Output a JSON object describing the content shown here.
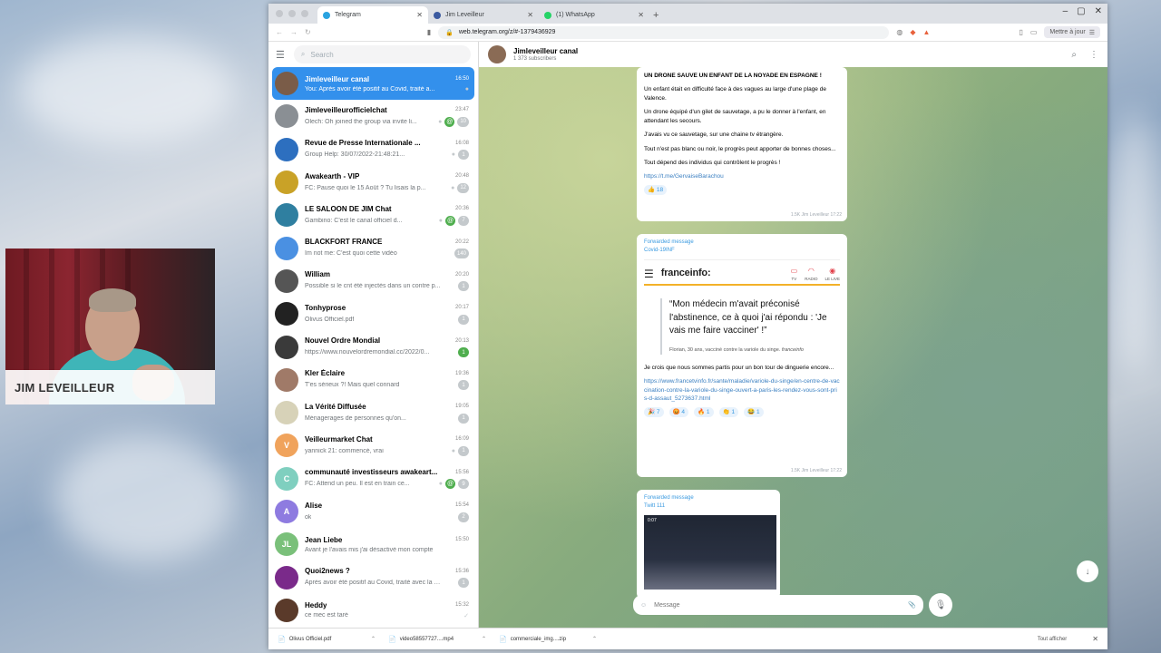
{
  "overlay": {
    "streamer_name": "JIM LEVEILLEUR"
  },
  "browser": {
    "tabs": [
      {
        "label": "Telegram",
        "color": "#2aa3e0",
        "active": true
      },
      {
        "label": "Jim Leveilleur",
        "color": "#3b5aa0",
        "active": false
      },
      {
        "label": "(1) WhatsApp",
        "color": "#25d366",
        "active": false
      }
    ],
    "url": "web.telegram.org/z/#-1379436929",
    "update_label": "Mettre à jour"
  },
  "sidebar": {
    "search_placeholder": "Search",
    "chats": [
      {
        "name": "Jimleveilleur canal",
        "time": "16:50",
        "msg": "You: Après avoir été positif au Covid, traité a...",
        "avatar_color": "#7a5c48",
        "initials": "",
        "active": true,
        "badges": [
          "pin"
        ]
      },
      {
        "name": "Jimleveilleurofficielchat",
        "time": "23:47",
        "msg": "Olech: Oh joined the group via invite li...",
        "avatar_color": "#8a8f94",
        "initials": "",
        "badges": [
          "pin",
          "mention",
          "count"
        ],
        "count": "10"
      },
      {
        "name": "Revue de Presse Internationale ...",
        "time": "16:08",
        "msg": "Group Help: 30/07/2022-21:48:21...",
        "avatar_color": "#2d6fbf",
        "initials": "",
        "badges": [
          "pin",
          "count"
        ],
        "count": "1"
      },
      {
        "name": "Awakearth - VIP",
        "time": "20:48",
        "msg": "FC: Pause quoi le 15 Août ? Tu lisais la p...",
        "avatar_color": "#c9a227",
        "initials": "",
        "badges": [
          "pin",
          "count"
        ],
        "count": "12"
      },
      {
        "name": "LE SALOON DE JIM Chat",
        "time": "20:36",
        "msg": "Gambino: C'est le canal officiel d...",
        "avatar_color": "#2f7fa0",
        "initials": "",
        "badges": [
          "pin",
          "mention",
          "count"
        ],
        "count": "7"
      },
      {
        "name": "BLACKFORT FRANCE",
        "time": "20:22",
        "msg": "Im not me: C'est quoi cette vidéo",
        "avatar_color": "#4a90e2",
        "initials": "",
        "badges": [
          "count"
        ],
        "count": "140"
      },
      {
        "name": "William",
        "time": "20:20",
        "msg": "Possible si le cnt été injectés dans un contre p...",
        "avatar_color": "#555555",
        "initials": "",
        "badges": [
          "count"
        ],
        "count": "1"
      },
      {
        "name": "Tonhyprose",
        "time": "20:17",
        "msg": "Olivus Officiel.pdf",
        "avatar_color": "#222222",
        "initials": "",
        "badges": [
          "count"
        ],
        "count": "1"
      },
      {
        "name": "Nouvel Ordre Mondial",
        "time": "20:13",
        "msg": "https://www.nouvelordremondial.cc/2022/0...",
        "avatar_color": "#3a3a3a",
        "initials": "",
        "badges": [
          "green-count"
        ],
        "count": "1"
      },
      {
        "name": "Kler Éclaire",
        "time": "19:36",
        "msg": "T'es sérieux ?! Mais quel connard",
        "avatar_color": "#a07a68",
        "initials": "",
        "badges": [
          "count"
        ],
        "count": "1"
      },
      {
        "name": "La Vérité Diffusée",
        "time": "19:05",
        "msg": "Ménagerages de personnes qu'on...",
        "avatar_color": "#d7d2b8",
        "initials": "",
        "badges": [
          "count"
        ],
        "count": "1"
      },
      {
        "name": "Veilleurmarket Chat",
        "time": "16:09",
        "msg": "yannick 21: commencé, vrai",
        "avatar_color": "#f0a35c",
        "initials": "V",
        "badges": [
          "pin",
          "count"
        ],
        "count": "1"
      },
      {
        "name": "communauté investisseurs awakeart...",
        "time": "15:56",
        "msg": "FC: Attend un peu. Il est en train ce...",
        "avatar_color": "#7fcfbf",
        "initials": "C",
        "badges": [
          "pin",
          "mention",
          "count"
        ],
        "count": "9"
      },
      {
        "name": "Alise",
        "time": "15:54",
        "msg": "ok",
        "avatar_color": "#8e7be0",
        "initials": "A",
        "badges": [
          "count"
        ],
        "count": "2"
      },
      {
        "name": "Jean Liebe",
        "time": "15:50",
        "msg": "Avant je l'avais mis j'ai désactivé mon compte",
        "avatar_color": "#7ac07a",
        "initials": "JL",
        "badges": [],
        "count": ""
      },
      {
        "name": "Quoi2news ?",
        "time": "15:36",
        "msg": "Après avoir été positif au Covid, traité avec la p...",
        "avatar_color": "#7a2a8a",
        "initials": "",
        "badges": [
          "count"
        ],
        "count": "1"
      },
      {
        "name": "Heddy",
        "time": "15:32",
        "msg": "ce mec est taré",
        "avatar_color": "#5a3a2a",
        "initials": "",
        "badges": [
          "check"
        ],
        "count": ""
      }
    ]
  },
  "chat": {
    "title": "Jimleveilleur canal",
    "subtitle": "1 373 subscribers",
    "msg1": {
      "headline": "UN DRONE SAUVE UN ENFANT DE LA NOYADE EN ESPAGNE !",
      "p1": "Un enfant était en difficulté face à des vagues au large d'une plage de Valence.",
      "p2": "Un drone équipé d'un gilet de sauvetage, a pu le donner à l'enfant, en attendant les secours.",
      "p3": "J'avais vu ce sauvetage, sur une chaine tv étrangère.",
      "p4": "Tout n'est pas blanc ou noir, le progrès peut apporter de bonnes choses...",
      "p5": "Tout dépend des individus qui contrôlent le progrès !",
      "link": "https://t.me/GervaiseBarachou",
      "reaction": "👍 18",
      "meta": "1.5K  Jim Leveilleur  17:22"
    },
    "msg2": {
      "forwarded": "Forwarded message",
      "from": "Covid-19INF",
      "brand": "franceinfo:",
      "nav_tv": "TV",
      "nav_radio": "RADIO",
      "nav_live": "LE LIVE",
      "quote": "“Mon médecin m'avait préconisé l'abstinence, ce à quoi j'ai répondu : 'Je vais me faire vacciner' !”",
      "cite": "Florian, 30 ans, vacciné contre la variole du singe.",
      "cite_brand": "franceinfo",
      "body": "Je crois que nous sommes partis pour un bon tour de dinguerie encore...",
      "link": "https://www.francetvinfo.fr/sante/maladie/variole-du-singe/en-centre-de-vaccination-contre-la-variole-du-singe-ouvert-a-paris-les-rendez-vous-sont-pris-d-assaut_5273637.html",
      "reactions": [
        "🎉 7",
        "😡 4",
        "🔥 1",
        "👏 1",
        "😂 1"
      ],
      "meta": "1.5K  Jim Leveilleur  17:22"
    },
    "msg3": {
      "forwarded": "Forwarded message",
      "from": "Twitt 111",
      "duration": "0:07"
    },
    "composer_placeholder": "Message"
  },
  "downloads": {
    "items": [
      "Olivus Officiel.pdf",
      "video58557727....mp4",
      "commerciale_img....zip"
    ],
    "show_all": "Tout afficher"
  }
}
